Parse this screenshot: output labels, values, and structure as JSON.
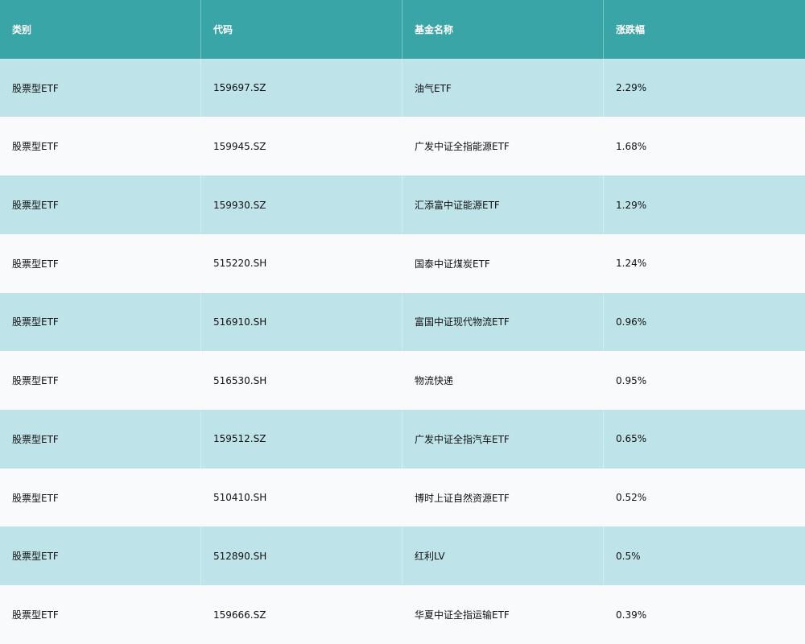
{
  "table": {
    "headers": [
      "类别",
      "代码",
      "基金名称",
      "涨跌幅"
    ],
    "rows": [
      [
        "股票型ETF",
        "159697.SZ",
        "油气ETF",
        "2.29%"
      ],
      [
        "股票型ETF",
        "159945.SZ",
        "广发中证全指能源ETF",
        "1.68%"
      ],
      [
        "股票型ETF",
        "159930.SZ",
        "汇添富中证能源ETF",
        "1.29%"
      ],
      [
        "股票型ETF",
        "515220.SH",
        "国泰中证煤炭ETF",
        "1.24%"
      ],
      [
        "股票型ETF",
        "516910.SH",
        "富国中证现代物流ETF",
        "0.96%"
      ],
      [
        "股票型ETF",
        "516530.SH",
        "物流快递",
        "0.95%"
      ],
      [
        "股票型ETF",
        "159512.SZ",
        "广发中证全指汽车ETF",
        "0.65%"
      ],
      [
        "股票型ETF",
        "510410.SH",
        "博时上证自然资源ETF",
        "0.52%"
      ],
      [
        "股票型ETF",
        "512890.SH",
        "红利LV",
        "0.5%"
      ],
      [
        "股票型ETF",
        "159666.SZ",
        "华夏中证全指运输ETF",
        "0.39%"
      ]
    ]
  },
  "colors": {
    "header_bg": "#3aa5a7",
    "odd_row_bg": "#bee4ea",
    "even_row_bg": "#f8fafb"
  }
}
